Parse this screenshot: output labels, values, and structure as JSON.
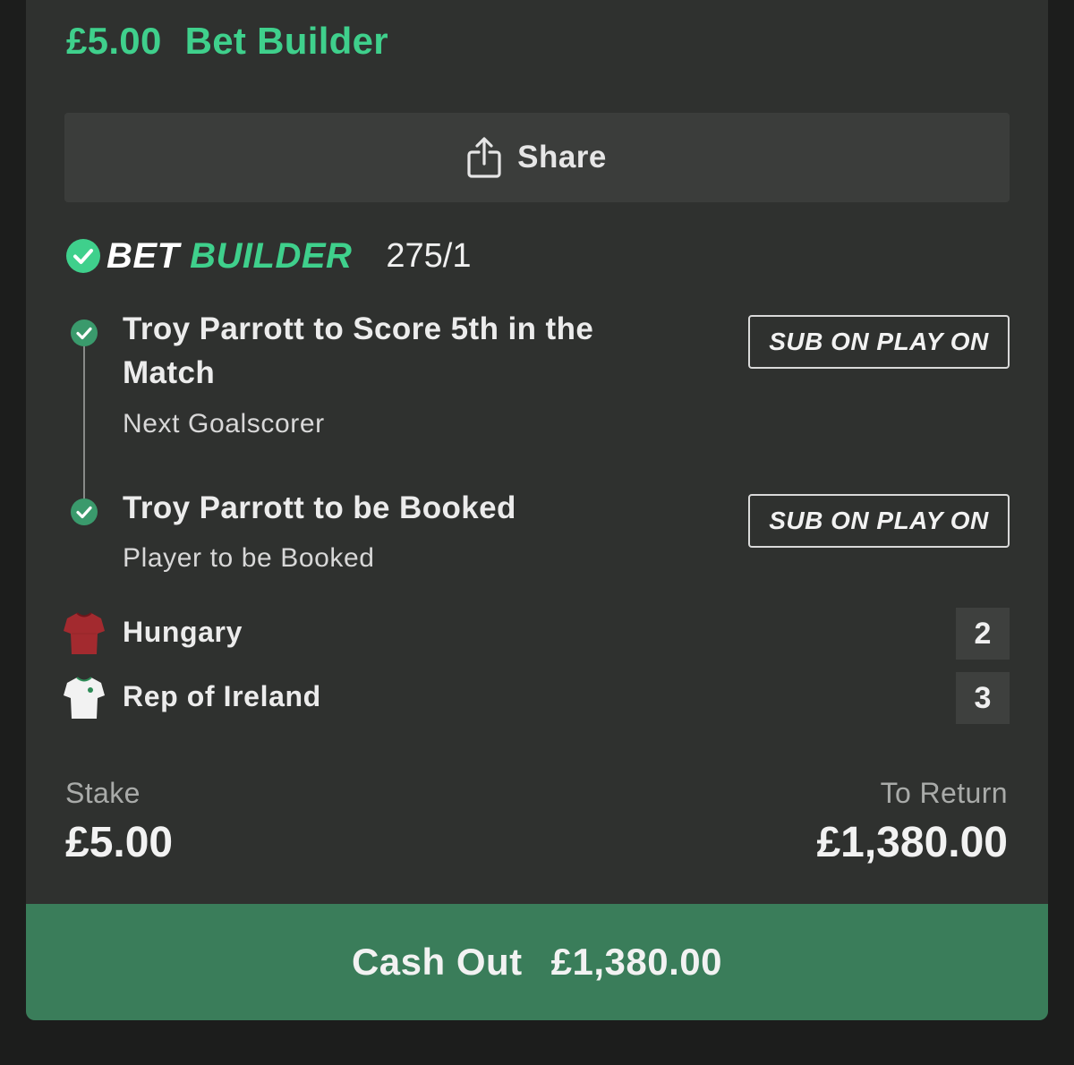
{
  "header": {
    "stake": "£5.00",
    "bet_type": "Bet Builder",
    "accent_color": "#3fd08c"
  },
  "share": {
    "label": "Share",
    "icon": "share-icon"
  },
  "bet_builder": {
    "logo_part1": "BET",
    "logo_part2": "BUILDER",
    "odds": "275/1",
    "status_icon": "check-circle-icon",
    "legs": [
      {
        "title_line1": "Troy Parrott to Score 5th in the",
        "title_line2": "Match",
        "market": "Next Goalscorer",
        "badge": "SUB ON PLAY ON",
        "status_icon": "check-circle-icon"
      },
      {
        "title_line1": "Troy Parrott to be Booked",
        "market": "Player to be Booked",
        "badge": "SUB ON PLAY ON",
        "status_icon": "check-circle-icon"
      }
    ]
  },
  "teams": [
    {
      "name": "Hungary",
      "score": "2",
      "icon": "red-shirt-icon",
      "shirt_color": "#a32a2f"
    },
    {
      "name": "Rep of Ireland",
      "score": "3",
      "icon": "white-shirt-icon",
      "shirt_color": "#f2f2f2"
    }
  ],
  "footer": {
    "stake_label": "Stake",
    "stake_value": "£5.00",
    "return_label": "To Return",
    "return_value": "£1,380.00"
  },
  "cashout": {
    "label": "Cash Out",
    "amount": "£1,380.00",
    "button_color": "#3a7d5a"
  }
}
